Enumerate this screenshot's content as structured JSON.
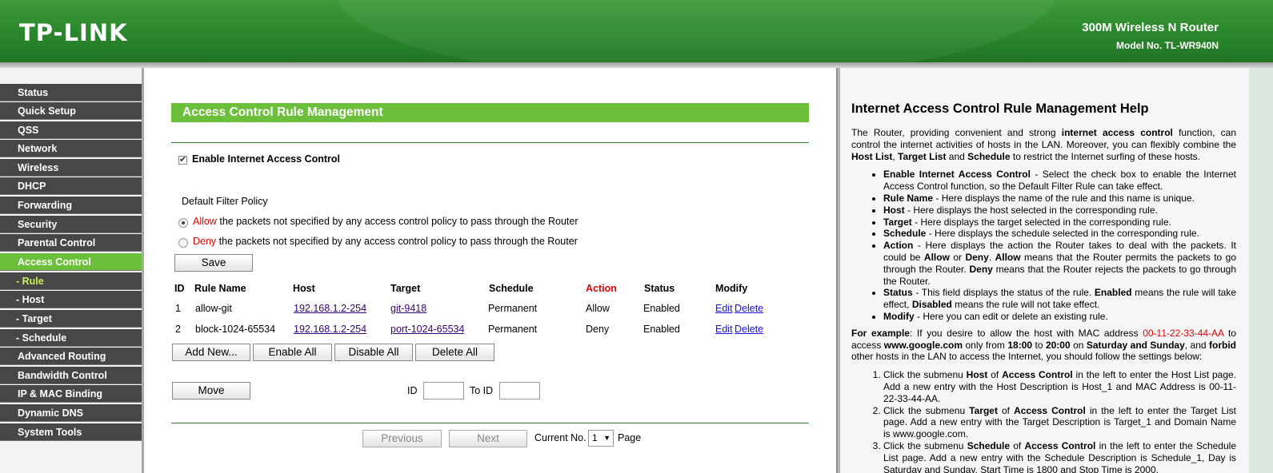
{
  "header": {
    "logo": "TP-LINK",
    "product": "300M Wireless N Router",
    "model": "Model No. TL-WR940N"
  },
  "sidebar": {
    "items": [
      {
        "label": "Status"
      },
      {
        "label": "Quick Setup"
      },
      {
        "label": "QSS"
      },
      {
        "label": "Network"
      },
      {
        "label": "Wireless"
      },
      {
        "label": "DHCP"
      },
      {
        "label": "Forwarding"
      },
      {
        "label": "Security"
      },
      {
        "label": "Parental Control"
      },
      {
        "label": "Access Control"
      },
      {
        "label": "- Rule"
      },
      {
        "label": "- Host"
      },
      {
        "label": "- Target"
      },
      {
        "label": "- Schedule"
      },
      {
        "label": "Advanced Routing"
      },
      {
        "label": "Bandwidth Control"
      },
      {
        "label": "IP & MAC Binding"
      },
      {
        "label": "Dynamic DNS"
      },
      {
        "label": "System Tools"
      }
    ]
  },
  "main": {
    "title": "Access Control Rule Management",
    "enable_label": "Enable Internet Access Control",
    "policy_heading": "Default Filter Policy",
    "allow_word": "Allow",
    "allow_rest": " the packets not specified by any access control policy to pass through the Router",
    "deny_word": "Deny",
    "deny_rest": " the packets not specified by any access control policy to pass through the Router",
    "selected_policy": "Allow",
    "save": "Save",
    "columns": [
      "ID",
      "Rule Name",
      "Host",
      "Target",
      "Schedule",
      "Action",
      "Status",
      "Modify"
    ],
    "rows": [
      {
        "id": "1",
        "name": "allow-git",
        "host": "192.168.1.2-254",
        "target": "git-9418",
        "schedule": "Permanent",
        "action": "Allow",
        "status": "Enabled",
        "edit": "Edit",
        "delete": "Delete"
      },
      {
        "id": "2",
        "name": "block-1024-65534",
        "host": "192.168.1.2-254",
        "target": "port-1024-65534",
        "schedule": "Permanent",
        "action": "Deny",
        "status": "Enabled",
        "edit": "Edit",
        "delete": "Delete"
      }
    ],
    "buttons": {
      "add": "Add New...",
      "enable_all": "Enable All",
      "disable_all": "Disable All",
      "delete_all": "Delete All",
      "move": "Move",
      "previous": "Previous",
      "next": "Next"
    },
    "move_id_label": "ID",
    "move_to_label": "To ID",
    "current_no_label": "Current No.",
    "page_value": "1",
    "page_label": "Page"
  },
  "help": {
    "title": "Internet Access Control Rule Management Help",
    "intro": [
      {
        "t": "The Router, providing convenient and strong "
      },
      {
        "b": "internet access control"
      },
      {
        "t": " function, can control the internet activities of hosts in the LAN. Moreover, you can flexibly combine the "
      },
      {
        "b": "Host List"
      },
      {
        "t": ", "
      },
      {
        "b": "Target List"
      },
      {
        "t": " and "
      },
      {
        "b": "Schedule"
      },
      {
        "t": " to restrict the Internet surfing of these hosts."
      }
    ],
    "bullets": [
      [
        {
          "b": "Enable Internet Access Control"
        },
        {
          "t": " - Select the check box to enable the Internet Access Control function, so the Default Filter Rule can take effect."
        }
      ],
      [
        {
          "b": "Rule Name"
        },
        {
          "t": " - Here displays the name of the rule and this name is unique."
        }
      ],
      [
        {
          "b": "Host"
        },
        {
          "t": " - Here displays the host selected in the corresponding rule."
        }
      ],
      [
        {
          "b": "Target"
        },
        {
          "t": " - Here displays the target selected in the corresponding rule."
        }
      ],
      [
        {
          "b": "Schedule"
        },
        {
          "t": " - Here displays the schedule selected in the corresponding rule."
        }
      ],
      [
        {
          "b": "Action"
        },
        {
          "t": " - Here displays the action the Router takes to deal with the packets. It could be "
        },
        {
          "b": "Allow"
        },
        {
          "t": " or "
        },
        {
          "b": "Deny"
        },
        {
          "t": ". "
        },
        {
          "b": "Allow"
        },
        {
          "t": " means that the Router permits the packets to go through the Router. "
        },
        {
          "b": "Deny"
        },
        {
          "t": " means that the Router rejects the packets to go through the Router."
        }
      ],
      [
        {
          "b": "Status"
        },
        {
          "t": " - This field displays the status of the rule. "
        },
        {
          "b": "Enabled"
        },
        {
          "t": " means the rule will take effect, "
        },
        {
          "b": "Disabled"
        },
        {
          "t": " means the rule will not take effect."
        }
      ],
      [
        {
          "b": "Modify"
        },
        {
          "t": " - Here you can edit or delete an existing rule."
        }
      ]
    ],
    "example": [
      {
        "b": "For example"
      },
      {
        "t": ": If you desire to allow the host with MAC address "
      },
      {
        "r": "00-11-22-33-44-AA"
      },
      {
        "t": " to access "
      },
      {
        "b": "www.google.com"
      },
      {
        "t": " only from "
      },
      {
        "b": "18:00"
      },
      {
        "t": " to "
      },
      {
        "b": "20:00"
      },
      {
        "t": " on "
      },
      {
        "b": "Saturday and Sunday"
      },
      {
        "t": ", and "
      },
      {
        "b": "forbid"
      },
      {
        "t": " other hosts in the LAN to access the Internet, you should follow the settings below:"
      }
    ],
    "steps": [
      [
        {
          "t": "Click the submenu "
        },
        {
          "b": "Host"
        },
        {
          "t": " of "
        },
        {
          "b": "Access Control"
        },
        {
          "t": " in the left to enter the Host List page. Add a new entry with the Host Description is Host_1 and MAC Address is 00-11-22-33-44-AA."
        }
      ],
      [
        {
          "t": "Click the submenu "
        },
        {
          "b": "Target"
        },
        {
          "t": " of "
        },
        {
          "b": "Access Control"
        },
        {
          "t": " in the left to enter the Target List page. Add a new entry with the Target Description is Target_1 and Domain Name is www.google.com."
        }
      ],
      [
        {
          "t": "Click the submenu "
        },
        {
          "b": "Schedule"
        },
        {
          "t": " of "
        },
        {
          "b": "Access Control"
        },
        {
          "t": " in the left to enter the Schedule List page. Add a new entry with the Schedule Description is Schedule_1, Day is Saturday and Sunday, Start Time is 1800 and Stop Time is 2000."
        }
      ]
    ]
  },
  "colors": {
    "brand_green": "#2d8a2e",
    "accent_green": "#6cbf3b",
    "nav_dark": "#474747",
    "red": "#e00000"
  }
}
